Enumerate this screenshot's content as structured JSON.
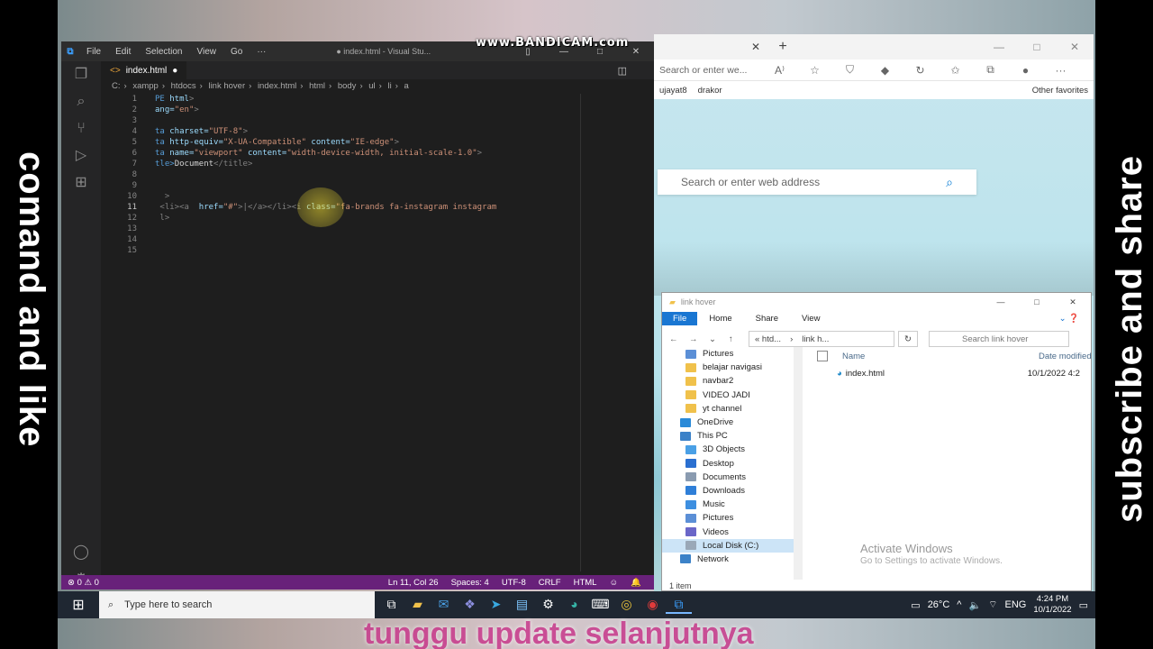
{
  "overlay": {
    "left": "comand and like",
    "right": "subscribe and share",
    "watermark": "www.BANDICAM.com",
    "bottom": "tunggu update selanjutnya"
  },
  "vscode": {
    "menu": [
      "File",
      "Edit",
      "Selection",
      "View",
      "Go",
      "···"
    ],
    "window_title": "● index.html - Visual Stu...",
    "tab": {
      "label": "index.html"
    },
    "breadcrumb": [
      "C:",
      "xampp",
      "htdocs",
      "link hover",
      "index.html",
      "html",
      "body",
      "ul",
      "li",
      "a"
    ],
    "lines": [
      {
        "n": "1",
        "parts": [
          [
            "t-tag",
            "PE "
          ],
          [
            "t-attr",
            "html"
          ],
          [
            "t-gray",
            ">"
          ]
        ]
      },
      {
        "n": "2",
        "parts": [
          [
            "t-attr",
            "ang="
          ],
          [
            "t-str",
            "\"en\""
          ],
          [
            "t-gray",
            ">"
          ]
        ]
      },
      {
        "n": "3",
        "parts": []
      },
      {
        "n": "4",
        "parts": [
          [
            "t-tag",
            "ta "
          ],
          [
            "t-attr",
            "charset="
          ],
          [
            "t-str",
            "\"UTF-8\""
          ],
          [
            "t-gray",
            ">"
          ]
        ]
      },
      {
        "n": "5",
        "parts": [
          [
            "t-tag",
            "ta "
          ],
          [
            "t-attr",
            "http-equiv="
          ],
          [
            "t-str",
            "\"X-UA-Compatible\" "
          ],
          [
            "t-attr",
            "content="
          ],
          [
            "t-str",
            "\"IE-edge\""
          ],
          [
            "t-gray",
            ">"
          ]
        ]
      },
      {
        "n": "6",
        "parts": [
          [
            "t-tag",
            "ta "
          ],
          [
            "t-attr",
            "name="
          ],
          [
            "t-str",
            "\"viewport\" "
          ],
          [
            "t-attr",
            "content="
          ],
          [
            "t-str",
            "\"width-device-width, initial-scale-1.0\""
          ],
          [
            "t-gray",
            ">"
          ]
        ]
      },
      {
        "n": "7",
        "parts": [
          [
            "t-tag",
            "tle>"
          ],
          [
            "t-txt",
            "Document"
          ],
          [
            "t-gray",
            "</title>"
          ]
        ]
      },
      {
        "n": "8",
        "parts": []
      },
      {
        "n": "9",
        "parts": []
      },
      {
        "n": "10",
        "parts": [
          [
            "t-gray",
            "  >"
          ]
        ]
      },
      {
        "n": "11",
        "parts": [
          [
            "t-gray",
            " <li><a  "
          ],
          [
            "t-attr",
            "href="
          ],
          [
            "t-str",
            "\"#\""
          ],
          [
            "t-gray",
            ">|</a></li><i "
          ],
          [
            "t-attr",
            "class="
          ],
          [
            "t-str",
            "\"fa-brands fa-instagram instagram"
          ]
        ]
      },
      {
        "n": "12",
        "parts": [
          [
            "t-gray",
            " l>"
          ]
        ]
      },
      {
        "n": "13",
        "parts": []
      },
      {
        "n": "14",
        "parts": []
      },
      {
        "n": "15",
        "parts": []
      }
    ],
    "status": {
      "errors": "⊗ 0 ⚠ 0",
      "position": "Ln 11, Col 26",
      "spaces": "Spaces: 4",
      "encoding": "UTF-8",
      "eol": "CRLF",
      "lang": "HTML"
    }
  },
  "edge": {
    "address_placeholder": "Search or enter we...",
    "fav_items": [
      "ujayat8",
      "drakor"
    ],
    "other_favorites": "Other favorites",
    "search_placeholder": "Search or enter web address"
  },
  "explorer": {
    "title": "link hover",
    "ribbon": [
      "File",
      "Home",
      "Share",
      "View"
    ],
    "path": [
      "« htd...",
      "›",
      "link h..."
    ],
    "search_placeholder": "Search link hover",
    "tree": [
      {
        "label": "Pictures",
        "color": "#5b8fd6",
        "indent": 26
      },
      {
        "label": "belajar navigasi",
        "color": "#f0c14b",
        "indent": 26
      },
      {
        "label": "navbar2",
        "color": "#f0c14b",
        "indent": 26
      },
      {
        "label": "VIDEO JADI",
        "color": "#f0c14b",
        "indent": 26
      },
      {
        "label": "yt channel",
        "color": "#f0c14b",
        "indent": 26
      },
      {
        "label": "OneDrive",
        "color": "#2a8ad8",
        "indent": 20
      },
      {
        "label": "This PC",
        "color": "#3c82c8",
        "indent": 20
      },
      {
        "label": "3D Objects",
        "color": "#4aa0e6",
        "indent": 26
      },
      {
        "label": "Desktop",
        "color": "#2a6fd0",
        "indent": 26
      },
      {
        "label": "Documents",
        "color": "#8a9bb0",
        "indent": 26
      },
      {
        "label": "Downloads",
        "color": "#2f7fd8",
        "indent": 26
      },
      {
        "label": "Music",
        "color": "#3d8fe0",
        "indent": 26
      },
      {
        "label": "Pictures",
        "color": "#5b8fd6",
        "indent": 26
      },
      {
        "label": "Videos",
        "color": "#6a66c8",
        "indent": 26
      },
      {
        "label": "Local Disk (C:)",
        "color": "#9aa8b8",
        "indent": 26,
        "selected": true
      },
      {
        "label": "Network",
        "color": "#3c82c8",
        "indent": 20
      }
    ],
    "columns": {
      "name": "Name",
      "date": "Date modified"
    },
    "files": [
      {
        "name": "index.html",
        "date": "10/1/2022 4:2"
      }
    ],
    "activate_title": "Activate Windows",
    "activate_sub": "Go to Settings to activate Windows.",
    "status": "1 item"
  },
  "taskbar": {
    "search_placeholder": "Type here to search",
    "temp": "26°C",
    "lang": "ENG",
    "time": "4:24 PM",
    "date": "10/1/2022"
  }
}
